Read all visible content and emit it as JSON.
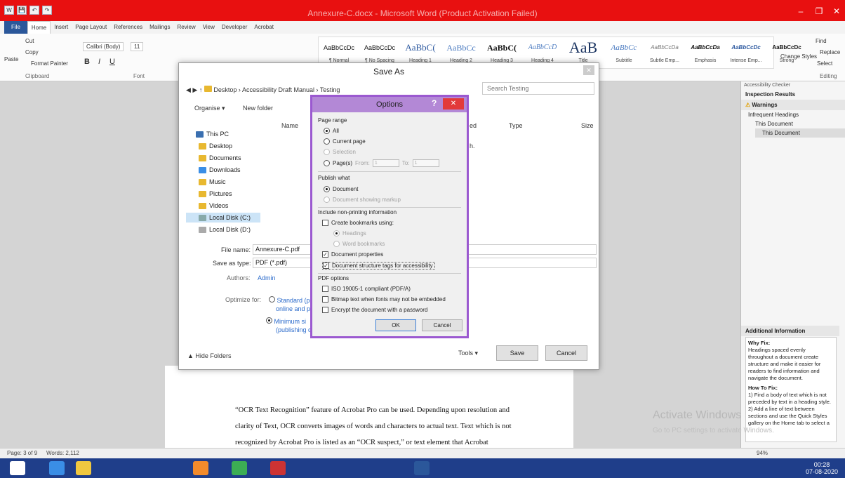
{
  "window": {
    "title": "Annexure-C.docx - Microsoft Word (Product Activation Failed)",
    "minimize": "–",
    "restore": "❐",
    "close": "✕"
  },
  "qat": [
    "W",
    "💾",
    "↶",
    "↷"
  ],
  "ribbon_tabs": [
    "File",
    "Home",
    "Insert",
    "Page Layout",
    "References",
    "Mailings",
    "Review",
    "View",
    "Developer",
    "Acrobat"
  ],
  "clipboard": {
    "cut": "Cut",
    "copy": "Copy",
    "paste": "Paste",
    "format_painter": "Format Painter",
    "group": "Clipboard"
  },
  "font": {
    "name": "Calibri (Body)",
    "size": "11",
    "group": "Font"
  },
  "styles": [
    {
      "sample": "AaBbCcDc",
      "name": "¶ Normal"
    },
    {
      "sample": "AaBbCcDc",
      "name": "¶ No Spacing"
    },
    {
      "sample": "AaBbC(",
      "name": "Heading 1"
    },
    {
      "sample": "AaBbCc",
      "name": "Heading 2"
    },
    {
      "sample": "AaBbC(",
      "name": "Heading 3"
    },
    {
      "sample": "AaBbCcD",
      "name": "Heading 4"
    },
    {
      "sample": "AaB",
      "name": "Title"
    },
    {
      "sample": "AaBbCc",
      "name": "Subtitle"
    },
    {
      "sample": "AaBbCcDa",
      "name": "Subtle Emp..."
    },
    {
      "sample": "AaBbCcDa",
      "name": "Emphasis"
    },
    {
      "sample": "AaBbCcDc",
      "name": "Intense Emp..."
    },
    {
      "sample": "AaBbCcDc",
      "name": "Strong"
    }
  ],
  "editing": {
    "find": "Find",
    "replace": "Replace",
    "select": "Select",
    "change_styles": "Change Styles",
    "group": "Editing"
  },
  "saveas": {
    "title": "Save As",
    "path": [
      "Desktop",
      "Accessibility Draft Manual",
      "Testing"
    ],
    "search_placeholder": "Search Testing",
    "organise": "Organise ▾",
    "new_folder": "New folder",
    "columns": {
      "name": "Name",
      "modified": "ed",
      "type": "Type",
      "size": "Size"
    },
    "empty_hint": "h.",
    "nav": [
      "This PC",
      "Desktop",
      "Documents",
      "Downloads",
      "Music",
      "Pictures",
      "Videos",
      "Local Disk (C:)",
      "Local Disk (D:)"
    ],
    "file_name_label": "File name:",
    "file_name": "Annexure-C.pdf",
    "save_type_label": "Save as type:",
    "save_type": "PDF (*.pdf)",
    "authors_label": "Authors:",
    "authors": "Admin",
    "optimize_label": "Optimize for:",
    "opt_standard": "Standard (p",
    "opt_standard2": "online and p",
    "opt_min": "Minimum si",
    "opt_min2": "(publishing o",
    "hide_folders": "Hide Folders",
    "tools": "Tools",
    "save": "Save",
    "cancel": "Cancel"
  },
  "options": {
    "title": "Options",
    "help": "?",
    "close": "✕",
    "page_range": "Page range",
    "all": "All",
    "current_page": "Current page",
    "selection": "Selection",
    "pages": "Page(s)",
    "from_label": "From:",
    "from": "1",
    "to_label": "To:",
    "to": "1",
    "publish_what": "Publish what",
    "document": "Document",
    "document_markup": "Document showing markup",
    "non_printing": "Include non-printing information",
    "create_bookmarks": "Create bookmarks using:",
    "headings": "Headings",
    "word_bookmarks": "Word bookmarks",
    "doc_properties": "Document properties",
    "structure_tags": "Document structure tags for accessibility",
    "pdf_options": "PDF options",
    "iso": "ISO 19005-1 compliant (PDF/A)",
    "bitmap": "Bitmap text when fonts may not be embedded",
    "encrypt": "Encrypt the document with a password",
    "ok": "OK",
    "cancel": "Cancel"
  },
  "document": {
    "lines": [
      "“OCR Text Recognition” feature of Acrobat Pro can be used.   Depending upon resolution and",
      "clarity of Text, OCR converts images of words and characters to actual text. Text which is not",
      "recognized by Acrobat Pro is listed as an “OCR suspect,” or text element that Acrobat"
    ]
  },
  "pane": {
    "header": "Accessibility Checker",
    "inspection": "Inspection Results",
    "warnings": "Warnings",
    "infrequent": "Infrequent Headings",
    "this_doc": "This Document",
    "this_doc_sel": "This Document",
    "additional": "Additional Information",
    "why_fix": "Why Fix:",
    "why_text": [
      "Headings spaced evenly",
      "throughout a document create",
      "structure and make it easier for",
      "readers to find information and",
      "navigate the document."
    ],
    "how_fix": "How To Fix:",
    "how_text": [
      "1) Find a body of text which is not",
      "preceded by text in a heading style.",
      "2) Add a line of text between",
      "sections and use the Quick Styles",
      "gallery on the Home tab to select a"
    ]
  },
  "watermark": {
    "line1": "Activate Windows",
    "line2": "Go to PC settings to activate Windows."
  },
  "status": {
    "page": "Page: 3 of 9",
    "words": "Words: 2,112",
    "zoom": "94%"
  },
  "tray": {
    "time": "00:28",
    "date": "07-08-2020"
  }
}
